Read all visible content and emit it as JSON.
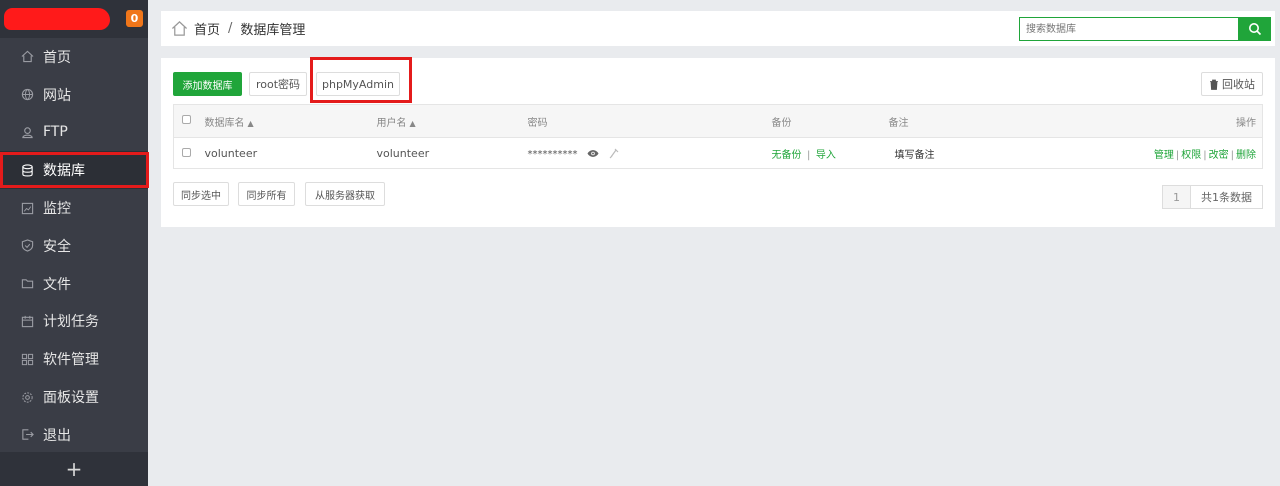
{
  "sidebar": {
    "badge": "0",
    "items": [
      {
        "label": "首页",
        "icon": "home-icon"
      },
      {
        "label": "网站",
        "icon": "globe-icon"
      },
      {
        "label": "FTP",
        "icon": "user-icon"
      },
      {
        "label": "数据库",
        "icon": "database-icon"
      },
      {
        "label": "监控",
        "icon": "monitor-icon"
      },
      {
        "label": "安全",
        "icon": "shield-icon"
      },
      {
        "label": "文件",
        "icon": "folder-icon"
      },
      {
        "label": "计划任务",
        "icon": "calendar-icon"
      },
      {
        "label": "软件管理",
        "icon": "apps-icon"
      },
      {
        "label": "面板设置",
        "icon": "gear-icon"
      },
      {
        "label": "退出",
        "icon": "logout-icon"
      }
    ],
    "active_index": 3,
    "add_label": "+"
  },
  "breadcrumb": {
    "home": "首页",
    "separator": "/",
    "current": "数据库管理"
  },
  "search": {
    "placeholder": "搜索数据库"
  },
  "toolbar": {
    "add_db": "添加数据库",
    "root_pwd": "root密码",
    "phpmyadmin": "phpMyAdmin",
    "recycle": "回收站"
  },
  "table": {
    "headers": [
      "数据库名",
      "用户名",
      "密码",
      "备份",
      "备注",
      "操作"
    ],
    "rows": [
      {
        "name": "volunteer",
        "user": "volunteer",
        "password": "**********",
        "backup": "无备份",
        "import": "导入",
        "note": "填写备注",
        "ops": [
          "管理",
          "权限",
          "改密",
          "删除"
        ]
      }
    ]
  },
  "bottom_buttons": {
    "sync_selected": "同步选中",
    "sync_all": "同步所有",
    "fetch_server": "从服务器获取"
  },
  "pager": {
    "page": "1",
    "total": "共1条数据"
  },
  "colors": {
    "accent": "#20a53a",
    "highlight": "#e41b1b",
    "sidebar_bg": "#3a3d46"
  }
}
